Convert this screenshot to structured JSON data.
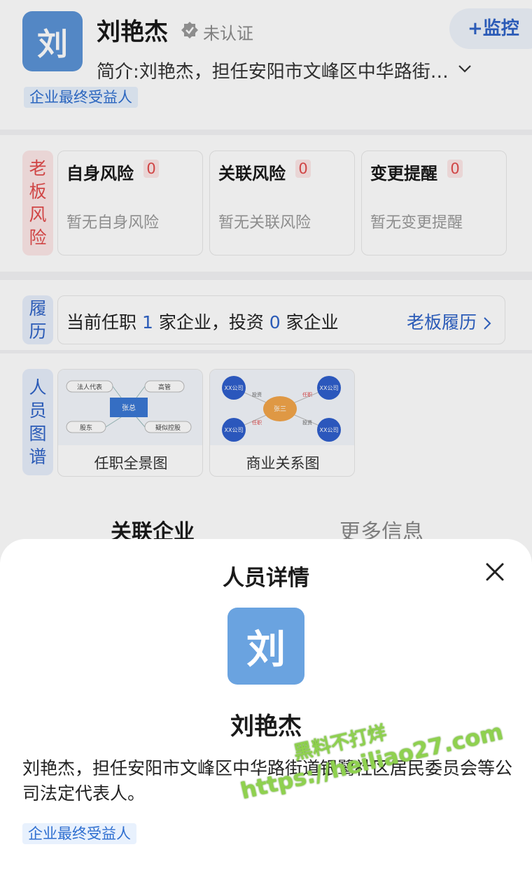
{
  "profile": {
    "avatar_char": "刘",
    "name": "刘艳杰",
    "verify_status": "未认证",
    "monitor_button": "+监控",
    "intro": "简介:刘艳杰，担任安阳市文峰区中华路街…",
    "tag": "企业最终受益人"
  },
  "risk": {
    "label": [
      "老",
      "板",
      "风",
      "险"
    ],
    "cards": [
      {
        "title": "自身风险",
        "count": "0",
        "empty": "暂无自身风险"
      },
      {
        "title": "关联风险",
        "count": "0",
        "empty": "暂无关联风险"
      },
      {
        "title": "变更提醒",
        "count": "0",
        "empty": "暂无变更提醒"
      }
    ]
  },
  "resume": {
    "label": [
      "履",
      "历"
    ],
    "text_prefix": "当前任职",
    "positions": "1",
    "text_mid": "家企业，投资",
    "investments": "0",
    "text_suffix": "家企业",
    "link": "老板履历"
  },
  "graph": {
    "label": [
      "人",
      "员",
      "图",
      "谱"
    ],
    "cards": [
      {
        "title": "任职全景图",
        "nodes": [
          "法人代表",
          "高管",
          "张总",
          "股东",
          "疑似控股"
        ]
      },
      {
        "title": "商业关系图",
        "nodes": [
          "XX公司",
          "XX公司",
          "张三",
          "XX公司",
          "XX公司",
          "投资",
          "任职",
          "任职",
          "投资"
        ]
      }
    ]
  },
  "tabs": [
    {
      "label": "关联企业"
    },
    {
      "label": "更多信息"
    }
  ],
  "sheet": {
    "title": "人员详情",
    "avatar_char": "刘",
    "name": "刘艳杰",
    "description": "刘艳杰，担任安阳市文峰区中华路街道银鹭社区居民委员会等公司法定代表人。",
    "tag": "企业最终受益人"
  },
  "watermark": {
    "line1": "黑料不打烊",
    "line2": "https://heiliao27.com"
  },
  "colors": {
    "accent": "#2f63c7",
    "risk_red": "#e24b4b",
    "avatar_blue": "#6aa3e0",
    "watermark_green": "#8fd14f"
  }
}
